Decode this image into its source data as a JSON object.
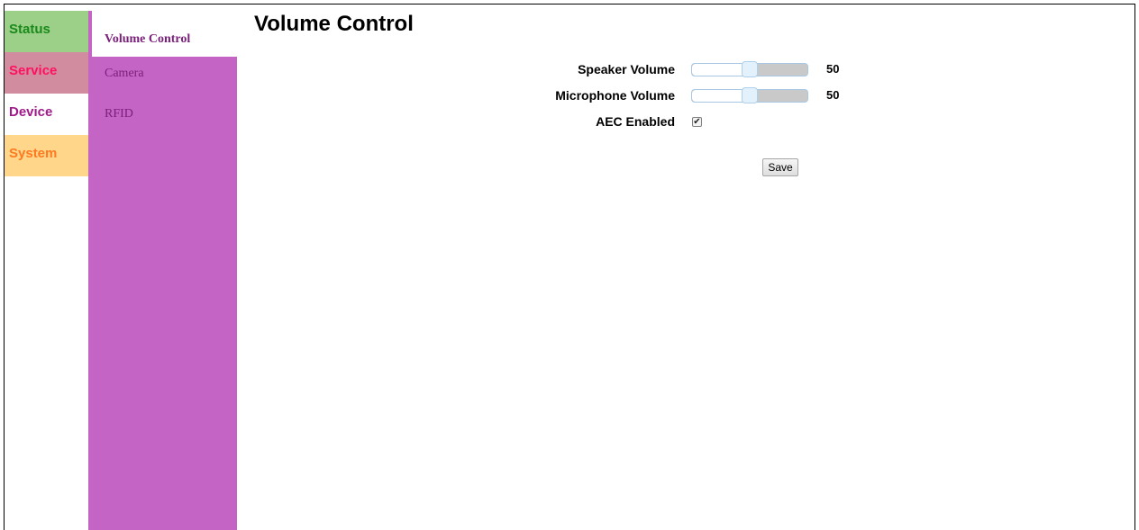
{
  "main_tabs": [
    {
      "label": "Status",
      "bg": "#9ccf88",
      "color": "#1a8a1a"
    },
    {
      "label": "Service",
      "bg": "#d28ca0",
      "color": "#ff1060"
    },
    {
      "label": "Device",
      "bg": "#ffffff",
      "color": "#a01a8a"
    },
    {
      "label": "System",
      "bg": "#ffd68a",
      "color": "#ff7a20"
    }
  ],
  "sub_nav": {
    "color": "#c464c4",
    "items": [
      {
        "label": "Volume Control",
        "active": true
      },
      {
        "label": "Camera",
        "active": false
      },
      {
        "label": "RFID",
        "active": false
      }
    ]
  },
  "page": {
    "title": "Volume Control",
    "speaker": {
      "label": "Speaker Volume",
      "value": "50",
      "level": 0.5
    },
    "microphone": {
      "label": "Microphone Volume",
      "value": "50",
      "level": 0.5
    },
    "aec": {
      "label": "AEC Enabled",
      "checked": true
    },
    "save_label": "Save"
  }
}
